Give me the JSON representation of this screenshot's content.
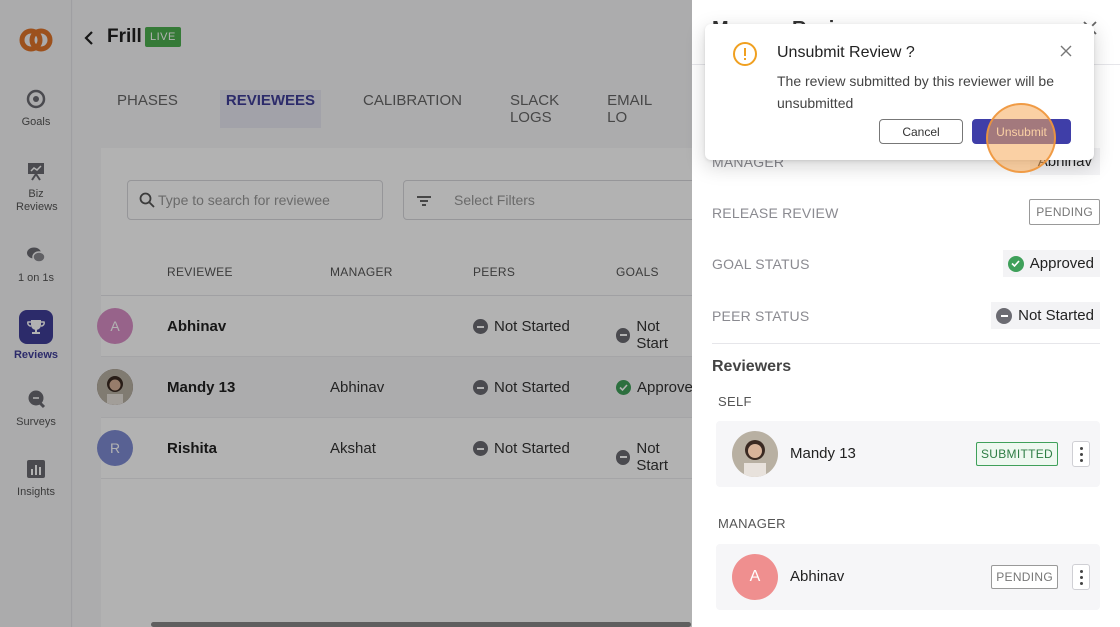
{
  "app": {
    "title": "Frill",
    "status_badge": "LIVE"
  },
  "sidebar": {
    "items": [
      {
        "label": "Goals",
        "icon": "target-icon"
      },
      {
        "label": "Biz Reviews",
        "icon": "presentation-icon"
      },
      {
        "label": "1 on 1s",
        "icon": "chat-bubbles-icon"
      },
      {
        "label": "Reviews",
        "icon": "trophy-icon",
        "active": true
      },
      {
        "label": "Surveys",
        "icon": "survey-bubble-icon"
      },
      {
        "label": "Insights",
        "icon": "bar-chart-icon"
      }
    ]
  },
  "tabs": [
    {
      "label": "PHASES"
    },
    {
      "label": "REVIEWEES",
      "active": true
    },
    {
      "label": "CALIBRATION"
    },
    {
      "label": "SLACK LOGS"
    },
    {
      "label": "EMAIL LO"
    }
  ],
  "search": {
    "placeholder": "Type to search for reviewee"
  },
  "filters": {
    "placeholder": "Select Filters"
  },
  "table": {
    "columns": [
      "REVIEWEE",
      "MANAGER",
      "PEERS",
      "GOALS"
    ],
    "rows": [
      {
        "avatar_initial": "A",
        "avatar_color": "#d88fc6",
        "name": "Abhinav",
        "manager": "",
        "peers": "Not Started",
        "goals": "Not Start"
      },
      {
        "avatar_initial": "",
        "avatar_color": "#6b5a4e",
        "name": "Mandy 13",
        "manager": "Abhinav",
        "peers": "Not Started",
        "goals": "Approve"
      },
      {
        "avatar_initial": "R",
        "avatar_color": "#7e8cd3",
        "name": "Rishita",
        "manager": "Akshat",
        "peers": "Not Started",
        "goals": "Not Start"
      }
    ]
  },
  "drawer": {
    "title": "Manage Review",
    "fields": {
      "manager": {
        "label": "MANAGER",
        "value": "Abhinav"
      },
      "release_review": {
        "label": "RELEASE REVIEW",
        "value": "PENDING"
      },
      "goal_status": {
        "label": "GOAL STATUS",
        "value": "Approved"
      },
      "peer_status": {
        "label": "PEER STATUS",
        "value": "Not Started"
      }
    },
    "reviewers_title": "Reviewers",
    "self": {
      "label": "SELF",
      "name": "Mandy 13",
      "badge": "SUBMITTED"
    },
    "manager_section": {
      "label": "MANAGER",
      "initial": "A",
      "name": "Abhinav",
      "badge": "PENDING",
      "avatar_color": "#ef8f8f"
    }
  },
  "dialog": {
    "title": "Unsubmit Review ?",
    "message": "The review submitted by this reviewer will be unsubmitted",
    "cancel_label": "Cancel",
    "confirm_label": "Unsubmit"
  },
  "colors": {
    "accent": "#3f3e99",
    "success": "#3fa05a",
    "warning": "#f0a020",
    "live": "#4caf50"
  }
}
